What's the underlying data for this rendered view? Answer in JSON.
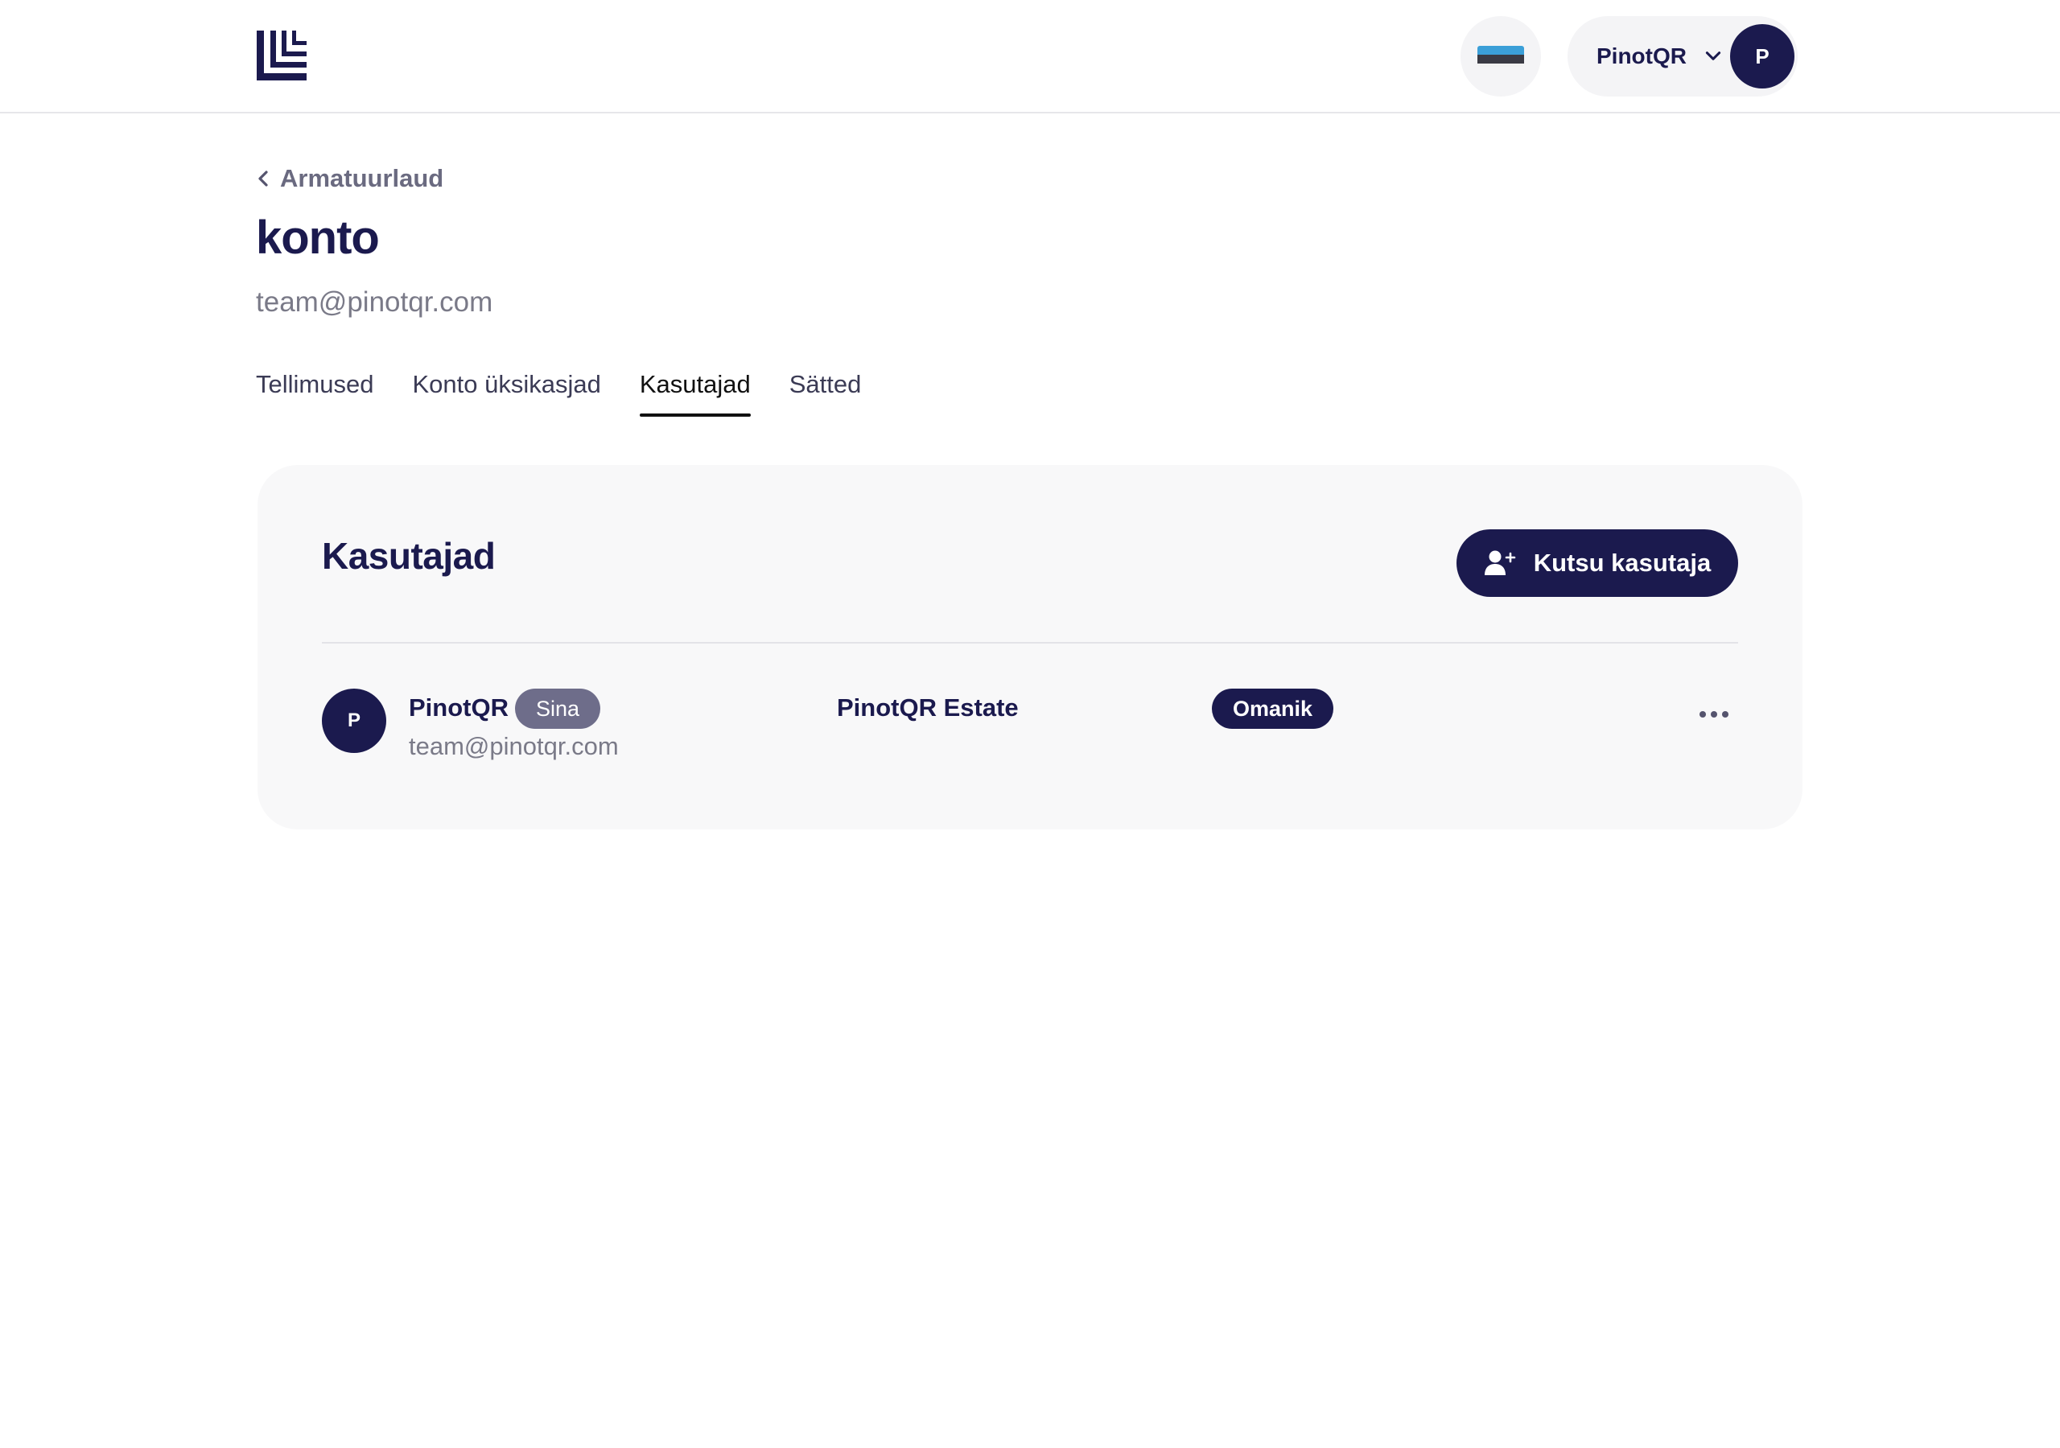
{
  "header": {
    "user_name": "PinotQR",
    "avatar_initial": "P",
    "brand_color": "#1b1a4e"
  },
  "page": {
    "back_label": "Armatuurlaud",
    "title": "konto",
    "email": "team@pinotqr.com"
  },
  "tabs": [
    {
      "label": "Tellimused",
      "active": false
    },
    {
      "label": "Konto üksikasjad",
      "active": false
    },
    {
      "label": "Kasutajad",
      "active": true
    },
    {
      "label": "Sätted",
      "active": false
    }
  ],
  "users_card": {
    "title": "Kasutajad",
    "invite_label": "Kutsu kasutaja",
    "rows": [
      {
        "initial": "P",
        "name": "PinotQR",
        "you_badge": "Sina",
        "email": "team@pinotqr.com",
        "organization": "PinotQR Estate",
        "role": "Omanik"
      }
    ]
  }
}
